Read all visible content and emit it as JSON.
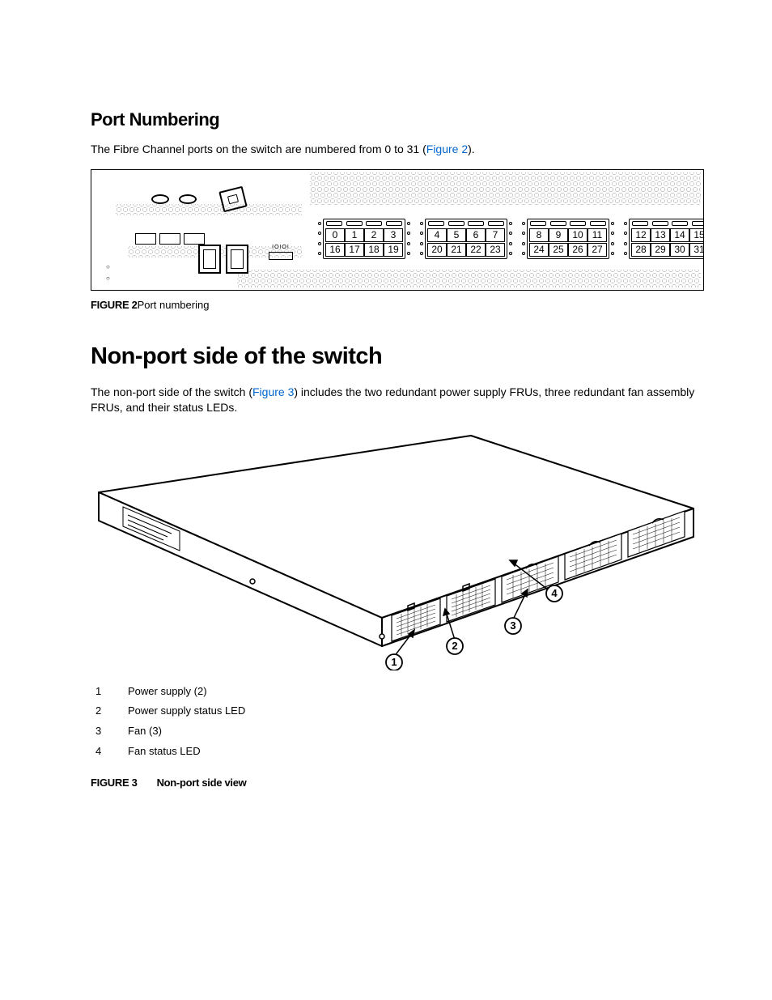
{
  "section1": {
    "heading": "Port Numbering",
    "intro_pre": "The Fibre Channel ports on the switch are numbered from 0 to 31 (",
    "intro_link": "Figure 2",
    "intro_post": ")."
  },
  "figure2": {
    "label": "FIGURE 2",
    "caption": "Port numbering",
    "port_groups": [
      {
        "top": [
          "0",
          "1",
          "2",
          "3"
        ],
        "bot": [
          "16",
          "17",
          "18",
          "19"
        ]
      },
      {
        "top": [
          "4",
          "5",
          "6",
          "7"
        ],
        "bot": [
          "20",
          "21",
          "22",
          "23"
        ]
      },
      {
        "top": [
          "8",
          "9",
          "10",
          "11"
        ],
        "bot": [
          "24",
          "25",
          "26",
          "27"
        ]
      },
      {
        "top": [
          "12",
          "13",
          "14",
          "15"
        ],
        "bot": [
          "28",
          "29",
          "30",
          "31"
        ]
      }
    ]
  },
  "section2": {
    "heading": "Non-port side of the switch",
    "intro_pre": "The non-port side of the switch (",
    "intro_link": "Figure 3",
    "intro_post": ") includes the two redundant power supply FRUs, three redundant fan assembly FRUs, and their status LEDs."
  },
  "figure3": {
    "label": "FIGURE 3",
    "caption": "Non-port side view",
    "legend": [
      {
        "n": "1",
        "t": "Power supply (2)"
      },
      {
        "n": "2",
        "t": "Power supply status LED"
      },
      {
        "n": "3",
        "t": "Fan (3)"
      },
      {
        "n": "4",
        "t": "Fan status LED"
      }
    ],
    "callouts": [
      "1",
      "2",
      "3",
      "4"
    ]
  }
}
